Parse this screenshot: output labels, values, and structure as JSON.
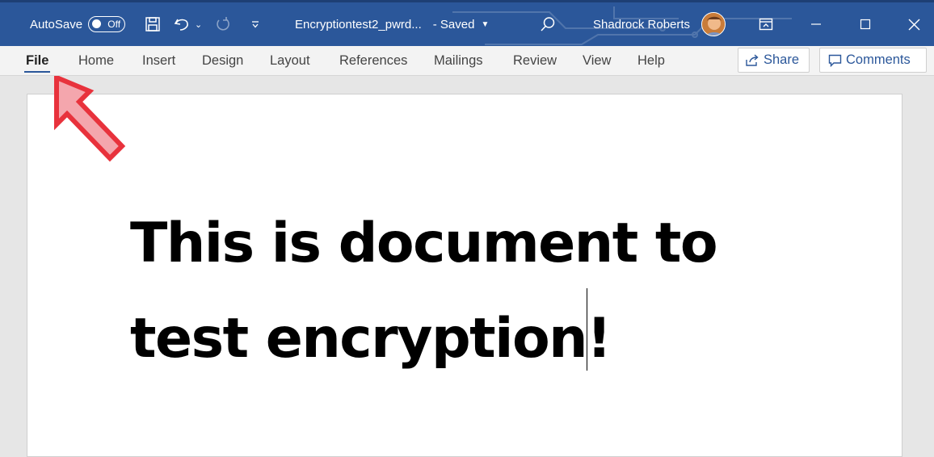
{
  "titlebar": {
    "autosave_label": "AutoSave",
    "autosave_state": "Off",
    "document_name": "Encryptiontest2_pwrd...",
    "save_status": "- Saved",
    "user_name": "Shadrock Roberts"
  },
  "ribbon": {
    "tabs": [
      "File",
      "Home",
      "Insert",
      "Design",
      "Layout",
      "References",
      "Mailings",
      "Review",
      "View",
      "Help"
    ],
    "share_label": "Share",
    "comments_label": "Comments"
  },
  "document": {
    "line1": "This is document to",
    "line2": "test encryption!"
  },
  "colors": {
    "title_bar": "#2b579a",
    "annotation_arrow": "#e8323c"
  },
  "icons": [
    "save-icon",
    "undo-icon",
    "redo-icon",
    "customize-toolbar-icon",
    "search-icon",
    "ribbon-display-icon",
    "minimize-icon",
    "maximize-icon",
    "close-icon",
    "share-icon",
    "comment-icon",
    "annotation-arrow"
  ]
}
